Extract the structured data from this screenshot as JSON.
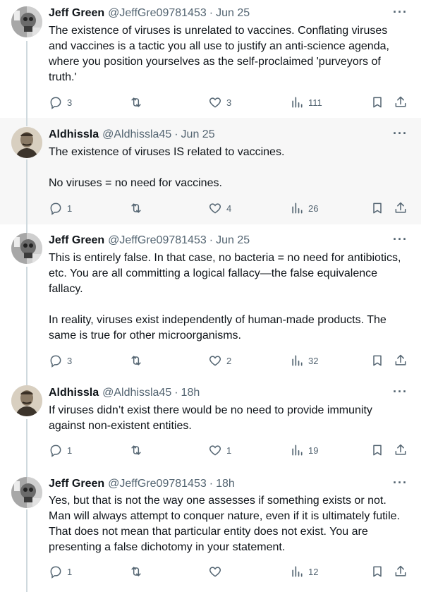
{
  "tweets": [
    {
      "name": "Jeff Green",
      "handle": "@JeffGre09781453",
      "time": "Jun 25",
      "text": "The existence of viruses is unrelated to vaccines. Conflating viruses and vaccines is a tactic you all use to justify an anti-science agenda, where you position yourselves as the self-proclaimed 'purveyors of truth.'",
      "replies": "3",
      "retweets": "",
      "likes": "3",
      "views": "111",
      "avatar_icon": "skull-collage-avatar"
    },
    {
      "name": "Aldhissla",
      "handle": "@Aldhissla45",
      "time": "Jun 25",
      "text": "The existence of viruses IS related to vaccines.\n\nNo viruses = no need for vaccines.",
      "replies": "1",
      "retweets": "",
      "likes": "4",
      "views": "26",
      "avatar_icon": "sepia-portrait-avatar"
    },
    {
      "name": "Jeff Green",
      "handle": "@JeffGre09781453",
      "time": "Jun 25",
      "text": "This is entirely false. In that case, no bacteria = no need for antibiotics, etc. You are all committing a logical fallacy—the false equivalence fallacy.\n\nIn reality, viruses exist independently of human-made products. The same is true for other microorganisms.",
      "replies": "3",
      "retweets": "",
      "likes": "2",
      "views": "32",
      "avatar_icon": "skull-collage-avatar"
    },
    {
      "name": "Aldhissla",
      "handle": "@Aldhissla45",
      "time": "18h",
      "text": "If viruses didn’t exist there would be no need to provide immunity against non-existent entities.",
      "replies": "1",
      "retweets": "",
      "likes": "1",
      "views": "19",
      "avatar_icon": "sepia-portrait-avatar"
    },
    {
      "name": "Jeff Green",
      "handle": "@JeffGre09781453",
      "time": "18h",
      "text": "Yes, but that is not the way one assesses if something exists or not. Man will always attempt to conquer nature, even if it is ultimately futile. That does not mean that particular entity does not exist. You are presenting a false dichotomy in your statement.",
      "replies": "1",
      "retweets": "",
      "likes": "",
      "views": "12",
      "avatar_icon": "skull-collage-avatar"
    }
  ],
  "ui": {
    "separator": "·",
    "more_label": "···"
  },
  "colors": {
    "text": "#0f1419",
    "secondary": "#536471",
    "highlight_bg": "#f7f7f7",
    "divider": "#eff3f4"
  }
}
